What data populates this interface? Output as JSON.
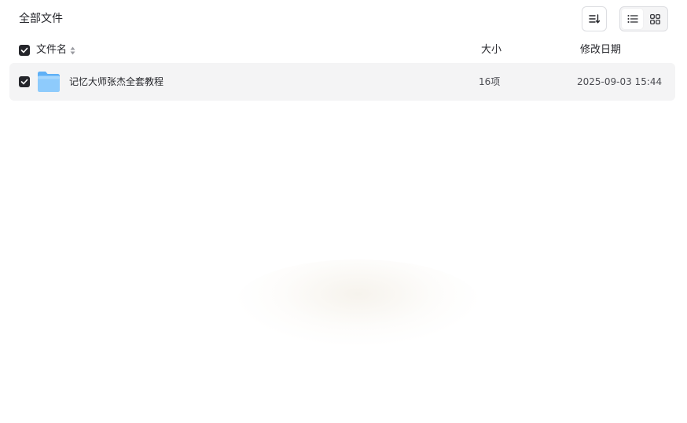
{
  "header": {
    "breadcrumb": "全部文件",
    "sort_icon": "sort-list-icon",
    "view_modes": [
      {
        "name": "list",
        "icon": "list-view-icon",
        "active": true
      },
      {
        "name": "grid",
        "icon": "grid-view-icon",
        "active": false
      }
    ]
  },
  "columns": {
    "name": "文件名",
    "size": "大小",
    "date": "修改日期"
  },
  "files": [
    {
      "name": "记忆大师张杰全套教程",
      "type": "folder",
      "size": "16项",
      "modified": "2025-09-03 15:44",
      "selected": true
    }
  ],
  "colors": {
    "text": "#25262b",
    "row_bg": "#f4f4f5",
    "folder": "#7cc1fb",
    "border": "#dcdde1"
  }
}
